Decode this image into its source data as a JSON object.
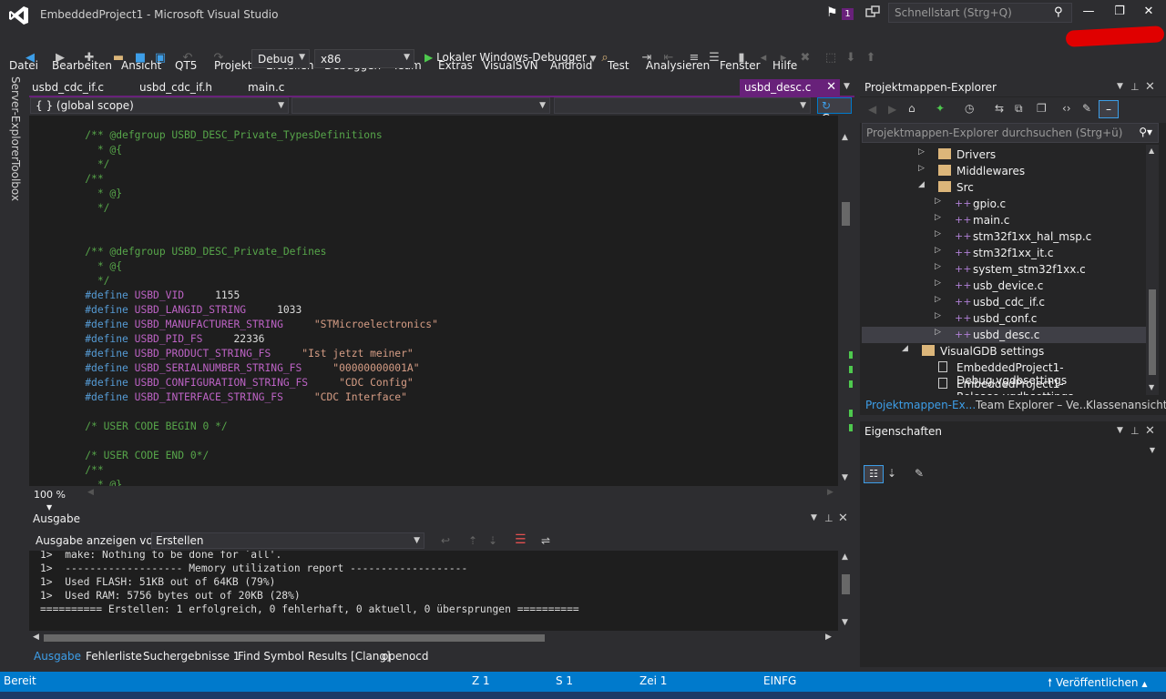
{
  "window": {
    "title": "EmbeddedProject1 - Microsoft Visual Studio",
    "notification_count": "1",
    "quick_launch_placeholder": "Schnellstart (Strg+Q)"
  },
  "menu": [
    "Datei",
    "Bearbeiten",
    "Ansicht",
    "QT5",
    "Projekt",
    "Erstellen",
    "Debuggen",
    "Team",
    "Extras",
    "VisualSVN",
    "Android",
    "Test",
    "Analysieren",
    "Fenster",
    "Hilfe"
  ],
  "toolbar": {
    "config": "Debug",
    "platform": "x86",
    "debugger": "Lokaler Windows-Debugger"
  },
  "side_tabs": [
    "Server-Explorer",
    "Toolbox"
  ],
  "doc_tabs": [
    "usbd_cdc_if.c",
    "usbd_cdc_if.h",
    "main.c"
  ],
  "active_tab": "usbd_desc.c",
  "nav": {
    "scope": "{ } (global scope)",
    "go": "Go"
  },
  "code_lines": [
    {
      "indent": "    ",
      "parts": [
        {
          "t": "/** @defgroup USBD_DESC_Private_TypesDefinitions",
          "c": "c-comment"
        }
      ]
    },
    {
      "indent": "      ",
      "parts": [
        {
          "t": "* @{",
          "c": "c-comment"
        }
      ]
    },
    {
      "indent": "      ",
      "parts": [
        {
          "t": "*/",
          "c": "c-comment"
        }
      ]
    },
    {
      "indent": "    ",
      "parts": [
        {
          "t": "/**",
          "c": "c-comment"
        }
      ]
    },
    {
      "indent": "      ",
      "parts": [
        {
          "t": "* @}",
          "c": "c-comment"
        }
      ]
    },
    {
      "indent": "      ",
      "parts": [
        {
          "t": "*/",
          "c": "c-comment"
        }
      ]
    },
    {
      "indent": "",
      "parts": []
    },
    {
      "indent": "",
      "parts": []
    },
    {
      "indent": "    ",
      "parts": [
        {
          "t": "/** @defgroup USBD_DESC_Private_Defines",
          "c": "c-comment"
        }
      ]
    },
    {
      "indent": "      ",
      "parts": [
        {
          "t": "* @{",
          "c": "c-comment"
        }
      ]
    },
    {
      "indent": "      ",
      "parts": [
        {
          "t": "*/",
          "c": "c-comment"
        }
      ]
    },
    {
      "indent": "    ",
      "parts": [
        {
          "t": "#define ",
          "c": "c-kw"
        },
        {
          "t": "USBD_VID",
          "c": "c-macro"
        },
        {
          "t": "     1155",
          "c": "c-num"
        }
      ]
    },
    {
      "indent": "    ",
      "parts": [
        {
          "t": "#define ",
          "c": "c-kw"
        },
        {
          "t": "USBD_LANGID_STRING",
          "c": "c-macro"
        },
        {
          "t": "     1033",
          "c": "c-num"
        }
      ]
    },
    {
      "indent": "    ",
      "parts": [
        {
          "t": "#define ",
          "c": "c-kw"
        },
        {
          "t": "USBD_MANUFACTURER_STRING",
          "c": "c-macro"
        },
        {
          "t": "     \"STMicroelectronics\"",
          "c": "c-str"
        }
      ]
    },
    {
      "indent": "    ",
      "parts": [
        {
          "t": "#define ",
          "c": "c-kw"
        },
        {
          "t": "USBD_PID_FS",
          "c": "c-macro"
        },
        {
          "t": "     22336",
          "c": "c-num"
        }
      ]
    },
    {
      "indent": "    ",
      "parts": [
        {
          "t": "#define ",
          "c": "c-kw"
        },
        {
          "t": "USBD_PRODUCT_STRING_FS",
          "c": "c-macro"
        },
        {
          "t": "     \"Ist jetzt meiner\"",
          "c": "c-str"
        }
      ]
    },
    {
      "indent": "    ",
      "parts": [
        {
          "t": "#define ",
          "c": "c-kw"
        },
        {
          "t": "USBD_SERIALNUMBER_STRING_FS",
          "c": "c-macro"
        },
        {
          "t": "     \"00000000001A\"",
          "c": "c-str"
        }
      ]
    },
    {
      "indent": "    ",
      "parts": [
        {
          "t": "#define ",
          "c": "c-kw"
        },
        {
          "t": "USBD_CONFIGURATION_STRING_FS",
          "c": "c-macro"
        },
        {
          "t": "     \"CDC Config\"",
          "c": "c-str"
        }
      ]
    },
    {
      "indent": "    ",
      "parts": [
        {
          "t": "#define ",
          "c": "c-kw"
        },
        {
          "t": "USBD_INTERFACE_STRING_FS",
          "c": "c-macro"
        },
        {
          "t": "     \"CDC Interface\"",
          "c": "c-str"
        }
      ]
    },
    {
      "indent": "",
      "parts": []
    },
    {
      "indent": "    ",
      "parts": [
        {
          "t": "/* USER CODE BEGIN 0 */",
          "c": "c-comment"
        }
      ]
    },
    {
      "indent": "",
      "parts": []
    },
    {
      "indent": "    ",
      "parts": [
        {
          "t": "/* USER CODE END 0*/",
          "c": "c-comment"
        }
      ]
    },
    {
      "indent": "    ",
      "parts": [
        {
          "t": "/**",
          "c": "c-comment"
        }
      ]
    },
    {
      "indent": "      ",
      "parts": [
        {
          "t": "* @}",
          "c": "c-comment"
        }
      ]
    },
    {
      "indent": "      ",
      "parts": [
        {
          "t": "*/",
          "c": "c-comment"
        }
      ]
    }
  ],
  "zoom": "100 %",
  "output": {
    "title": "Ausgabe",
    "show_from_label": "Ausgabe anzeigen von:",
    "source": "Erstellen",
    "lines": [
      "1>  make: Nothing to be done for `all'.",
      "1>  ------------------- Memory utilization report -------------------",
      "1>  Used FLASH: 51KB out of 64KB (79%)",
      "1>  Used RAM: 5756 bytes out of 20KB (28%)",
      "========== Erstellen: 1 erfolgreich, 0 fehlerhaft, 0 aktuell, 0 übersprungen =========="
    ]
  },
  "bottom_tabs": [
    "Ausgabe",
    "Fehlerliste",
    "Suchergebnisse 1",
    "Find Symbol Results [Clang]",
    "openocd"
  ],
  "solution_explorer": {
    "title": "Projektmappen-Explorer",
    "search_placeholder": "Projektmappen-Explorer durchsuchen (Strg+ü)",
    "tree": [
      {
        "label": "Drivers",
        "type": "folder",
        "arrow": "collapsed",
        "level": 2
      },
      {
        "label": "Middlewares",
        "type": "folder",
        "arrow": "collapsed",
        "level": 2
      },
      {
        "label": "Src",
        "type": "folder",
        "arrow": "expanded",
        "level": 2
      },
      {
        "label": "gpio.c",
        "type": "cfile",
        "arrow": "collapsed",
        "level": 3
      },
      {
        "label": "main.c",
        "type": "cfile",
        "arrow": "collapsed",
        "level": 3
      },
      {
        "label": "stm32f1xx_hal_msp.c",
        "type": "cfile",
        "arrow": "collapsed",
        "level": 3
      },
      {
        "label": "stm32f1xx_it.c",
        "type": "cfile",
        "arrow": "collapsed",
        "level": 3
      },
      {
        "label": "system_stm32f1xx.c",
        "type": "cfile",
        "arrow": "collapsed",
        "level": 3
      },
      {
        "label": "usb_device.c",
        "type": "cfile",
        "arrow": "collapsed",
        "level": 3
      },
      {
        "label": "usbd_cdc_if.c",
        "type": "cfile",
        "arrow": "collapsed",
        "level": 3
      },
      {
        "label": "usbd_conf.c",
        "type": "cfile",
        "arrow": "collapsed",
        "level": 3
      },
      {
        "label": "usbd_desc.c",
        "type": "cfile",
        "arrow": "collapsed",
        "level": 3,
        "selected": true
      },
      {
        "label": "VisualGDB settings",
        "type": "folder",
        "arrow": "expanded",
        "level": 1
      },
      {
        "label": "EmbeddedProject1-Debug.vgdbsettings",
        "type": "file",
        "arrow": "none",
        "level": 2
      },
      {
        "label": "EmbeddedProject1-Release.vgdbsettings",
        "type": "file",
        "arrow": "none",
        "level": 2
      }
    ],
    "tabs": [
      "Projektmappen-Ex...",
      "Team Explorer – Ve...",
      "Klassenansicht"
    ]
  },
  "properties": {
    "title": "Eigenschaften"
  },
  "status": {
    "ready": "Bereit",
    "line": "Z 1",
    "col": "S 1",
    "char": "Zei 1",
    "mode": "EINFG",
    "publish": "Veröffentlichen"
  },
  "colors": {
    "accent": "#68217a",
    "statusbar": "#007acc"
  }
}
